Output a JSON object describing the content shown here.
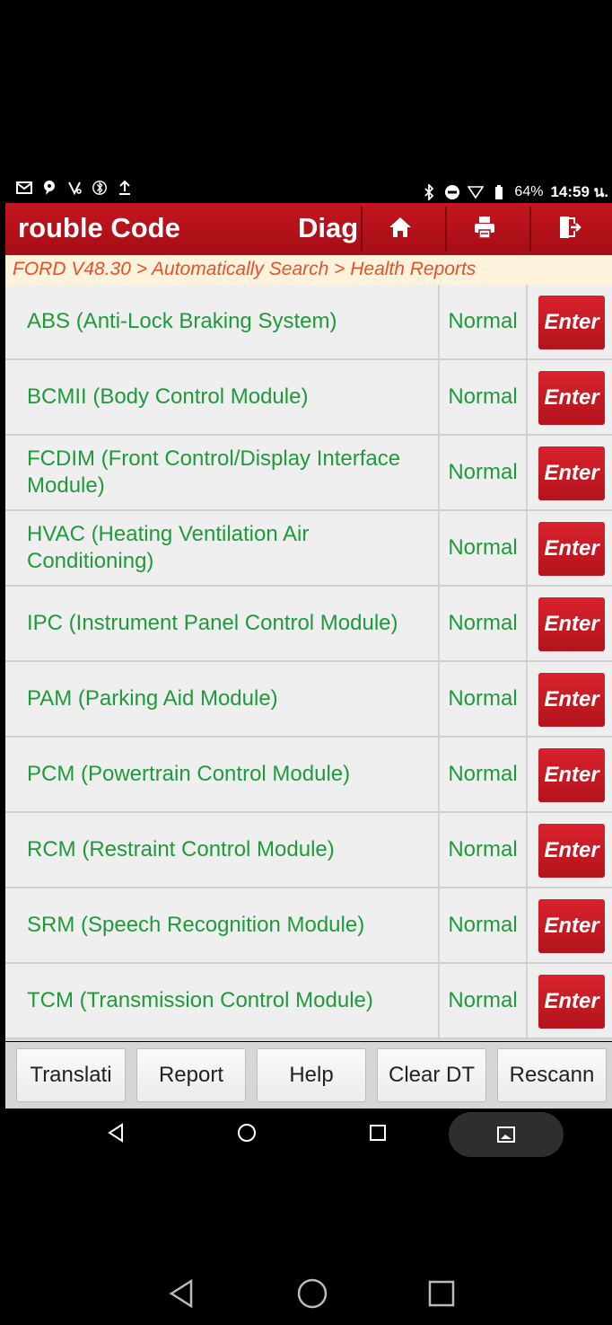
{
  "status_bar": {
    "battery": "64%",
    "time": "14:59 น."
  },
  "header": {
    "title": "rouble Code",
    "title_secondary": "Diag"
  },
  "breadcrumb": "FORD V48.30 > Automatically Search > Health Reports",
  "modules": [
    {
      "name": "ABS (Anti-Lock Braking System)",
      "status": "Normal",
      "action": "Enter"
    },
    {
      "name": "BCMII (Body Control Module)",
      "status": "Normal",
      "action": "Enter"
    },
    {
      "name": "FCDIM (Front Control/Display Interface Module)",
      "status": "Normal",
      "action": "Enter"
    },
    {
      "name": "HVAC (Heating Ventilation Air Conditioning)",
      "status": "Normal",
      "action": "Enter"
    },
    {
      "name": "IPC (Instrument Panel Control Module)",
      "status": "Normal",
      "action": "Enter"
    },
    {
      "name": "PAM (Parking Aid Module)",
      "status": "Normal",
      "action": "Enter"
    },
    {
      "name": "PCM (Powertrain Control Module)",
      "status": "Normal",
      "action": "Enter"
    },
    {
      "name": "RCM (Restraint Control Module)",
      "status": "Normal",
      "action": "Enter"
    },
    {
      "name": "SRM (Speech Recognition Module)",
      "status": "Normal",
      "action": "Enter"
    },
    {
      "name": "TCM (Transmission Control Module)",
      "status": "Normal",
      "action": "Enter"
    }
  ],
  "toolbar": {
    "translate": "Translati",
    "report": "Report",
    "help": "Help",
    "clear_dtc": "Clear DT",
    "rescan": "Rescann"
  },
  "colors": {
    "header_red": "#c4161f",
    "module_green": "#1f9a3a",
    "breadcrumb_orange": "#e8502a",
    "enter_red": "#d8232d"
  }
}
